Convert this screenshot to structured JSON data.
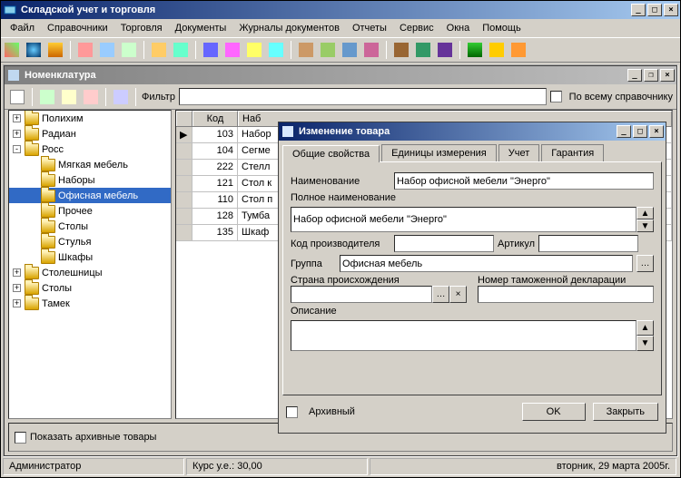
{
  "app": {
    "title": "Складской учет и торговля",
    "menus": [
      "Файл",
      "Справочники",
      "Торговля",
      "Документы",
      "Журналы документов",
      "Отчеты",
      "Сервис",
      "Окна",
      "Помощь"
    ]
  },
  "child": {
    "title": "Номенклатура",
    "filter_label": "Фильтр",
    "search_all_label": "По всему справочнику",
    "show_archived_label": "Показать архивные товары",
    "tree": [
      {
        "pm": "+",
        "indent": 0,
        "name": "Полихим"
      },
      {
        "pm": "+",
        "indent": 0,
        "name": "Радиан"
      },
      {
        "pm": "-",
        "indent": 0,
        "name": "Росс"
      },
      {
        "pm": "",
        "indent": 1,
        "name": "Мягкая мебель"
      },
      {
        "pm": "",
        "indent": 1,
        "name": "Наборы"
      },
      {
        "pm": "",
        "indent": 1,
        "name": "Офисная мебель",
        "sel": true
      },
      {
        "pm": "",
        "indent": 1,
        "name": "Прочее"
      },
      {
        "pm": "",
        "indent": 1,
        "name": "Столы"
      },
      {
        "pm": "",
        "indent": 1,
        "name": "Стулья"
      },
      {
        "pm": "",
        "indent": 1,
        "name": "Шкафы"
      },
      {
        "pm": "+",
        "indent": 0,
        "name": "Столешницы"
      },
      {
        "pm": "+",
        "indent": 0,
        "name": "Столы"
      },
      {
        "pm": "+",
        "indent": 0,
        "name": "Тамек"
      }
    ],
    "grid_headers": [
      "",
      "Код",
      "Наб"
    ],
    "grid_rows": [
      {
        "code": "103",
        "name": "Набор"
      },
      {
        "code": "104",
        "name": "Сегме"
      },
      {
        "code": "222",
        "name": "Стелл"
      },
      {
        "code": "121",
        "name": "Стол к"
      },
      {
        "code": "110",
        "name": "Стол п"
      },
      {
        "code": "128",
        "name": "Тумба"
      },
      {
        "code": "135",
        "name": "Шкаф"
      }
    ]
  },
  "dialog": {
    "title": "Изменение товара",
    "tabs": [
      "Общие свойства",
      "Единицы измерения",
      "Учет",
      "Гарантия"
    ],
    "name_label": "Наименование",
    "name_value": "Набор офисной мебели \"Энерго\"",
    "fullname_label": "Полное наименование",
    "fullname_value": "Набор офисной мебели \"Энерго\"",
    "mfrcode_label": "Код производителя",
    "article_label": "Артикул",
    "group_label": "Группа",
    "group_value": "Офисная мебель",
    "country_label": "Страна происхождения",
    "customs_label": "Номер таможенной декларации",
    "desc_label": "Описание",
    "archived_label": "Архивный",
    "ok": "OK",
    "close": "Закрыть"
  },
  "status": {
    "user": "Администратор",
    "rate": "Курс у.е.: 30,00",
    "date": "вторник, 29 марта 2005г."
  }
}
